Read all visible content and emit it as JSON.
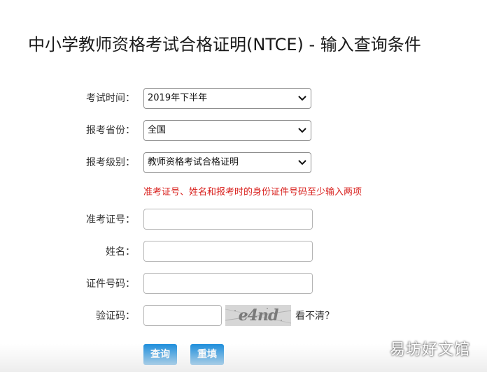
{
  "page": {
    "title": "中小学教师资格考试合格证明(NTCE) - 输入查询条件"
  },
  "form": {
    "exam_time": {
      "label": "考试时间：",
      "value": "2019年下半年"
    },
    "province": {
      "label": "报考省份：",
      "value": "全国"
    },
    "level": {
      "label": "报考级别：",
      "value": "教师资格考试合格证明"
    },
    "notice": "准考证号、姓名和报考时的身份证件号码至少输入两项",
    "ticket_no": {
      "label": "准考证号：",
      "value": ""
    },
    "name": {
      "label": "姓名：",
      "value": ""
    },
    "id_no": {
      "label": "证件号码：",
      "value": ""
    },
    "captcha": {
      "label": "验证码：",
      "value": "",
      "image_text": "e4nd",
      "refresh_label": "看不清？"
    },
    "query_label": "查询",
    "reset_label": "重填"
  },
  "watermark": "易坊好文馆",
  "colors": {
    "accent": "#1f8fdc",
    "notice": "#d9211e"
  }
}
